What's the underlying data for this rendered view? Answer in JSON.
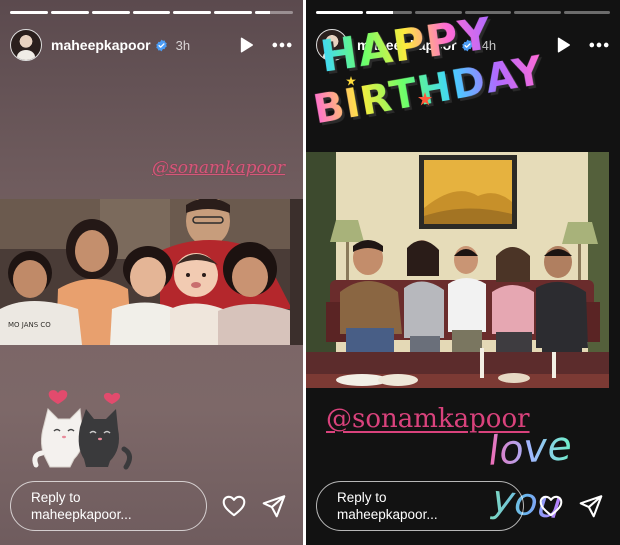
{
  "stories": [
    {
      "username": "maheepkapoor",
      "time_ago": "3h",
      "progress": [
        1,
        1,
        1,
        1,
        1,
        1,
        0.4
      ],
      "mention": "@sonamkapoor",
      "reply_placeholder": "Reply to maheepkapoor...",
      "reply_line1": "Reply to",
      "reply_line2": "maheepkapoor...",
      "photo_caption_shirt": "MO JANS CO"
    },
    {
      "username": "maheepkapoor",
      "time_ago": "4h",
      "progress": [
        1,
        0.6,
        0,
        0,
        0,
        0
      ],
      "sticker_line1": "HAPPY",
      "sticker_line2": "BIRTHDAY",
      "mention": "@sonamkapoor",
      "love_text": "love",
      "you_text": "you",
      "reply_placeholder": "Reply to maheepkapoor...",
      "reply_line1": "Reply to",
      "reply_line2": "maheepkapoor..."
    }
  ]
}
